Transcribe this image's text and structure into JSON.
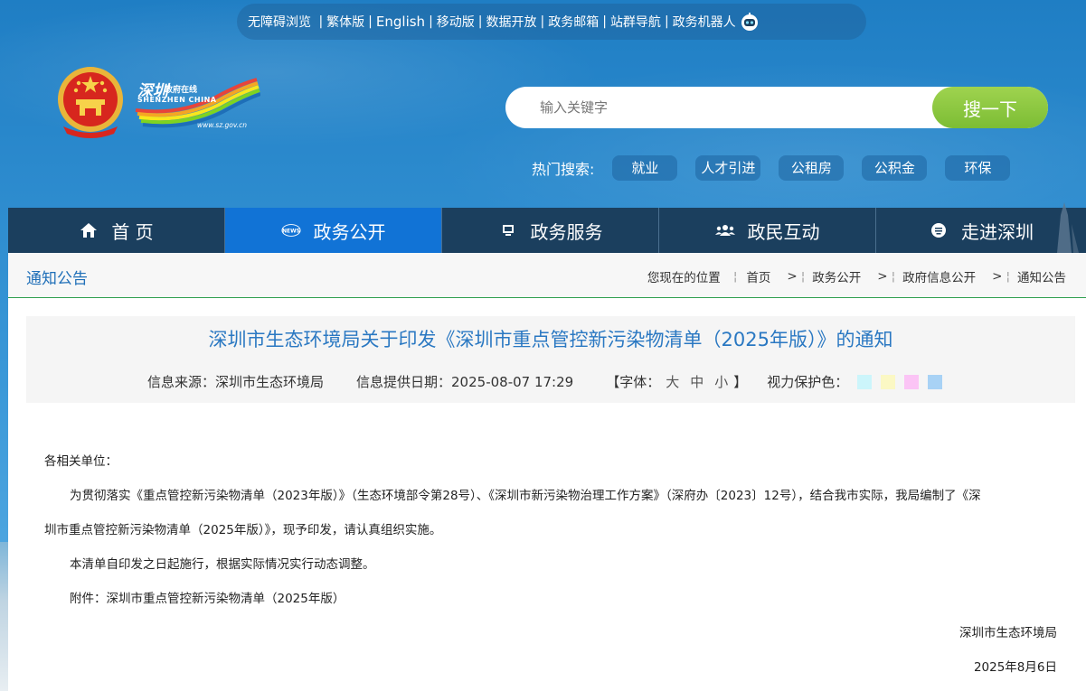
{
  "top_links": [
    {
      "label": "无障碍浏览"
    },
    {
      "label": "繁体版"
    },
    {
      "label": "English"
    },
    {
      "label": "移动版"
    },
    {
      "label": "数据开放"
    },
    {
      "label": "政务邮箱"
    },
    {
      "label": "站群导航"
    },
    {
      "label": "政务机器人"
    }
  ],
  "logo": {
    "cn": "深圳",
    "cn_small": "政府在线",
    "en": "SHENZHEN CHINA",
    "url": "www.sz.gov.cn"
  },
  "search": {
    "placeholder": "输入关键字",
    "button": "搜一下"
  },
  "hot_search": {
    "label": "热门搜索:",
    "tags": [
      "就业",
      "人才引进",
      "公租房",
      "公积金",
      "环保"
    ]
  },
  "nav": {
    "items": [
      {
        "label": "首 页",
        "icon": "home-icon"
      },
      {
        "label": "政务公开",
        "icon": "news-icon"
      },
      {
        "label": "政务服务",
        "icon": "monitor-icon"
      },
      {
        "label": "政民互动",
        "icon": "people-icon"
      },
      {
        "label": "走进深圳",
        "icon": "chat-icon"
      }
    ],
    "active_index": 1
  },
  "breadcrumb": {
    "section_title": "通知公告",
    "location_label": "您现在的位置",
    "items": [
      "首页",
      "政务公开",
      "政府信息公开",
      "通知公告"
    ]
  },
  "article": {
    "title": "深圳市生态环境局关于印发《深圳市重点管控新污染物清单（2025年版）》的通知",
    "source_label": "信息来源：深圳市生态环境局",
    "date_label": "信息提供日期：2025-08-07 17:29",
    "font_open": "【字体：",
    "font_large": "大",
    "font_medium": "中",
    "font_small": "小",
    "font_close": "】",
    "eye_label": "视力保护色：",
    "eye_colors": [
      "#ccf5fb",
      "#fbf8c4",
      "#fbc4f5",
      "#a8d2f5"
    ],
    "salutation": "各相关单位：",
    "para1_line1": "为贯彻落实《重点管控新污染物清单（2023年版）》（生态环境部令第28号）、《深圳市新污染物治理工作方案》（深府办〔2023〕12号），结合我市实际，我局编制了《深",
    "para1_line2": "圳市重点管控新污染物清单（2025年版）》，现予印发，请认真组织实施。",
    "para2": "本清单自印发之日起施行，根据实际情况实行动态调整。",
    "attachment": "附件：深圳市重点管控新污染物清单（2025年版）",
    "signature": "深圳市生态环境局",
    "sign_date": "2025年8月6日"
  },
  "colors": {
    "nav_bg": "#1b3f5e",
    "nav_active": "#1173d6",
    "search_btn": "#8cc63f",
    "title_blue": "#2a78c2",
    "divider_green": "#2e9e4e"
  }
}
